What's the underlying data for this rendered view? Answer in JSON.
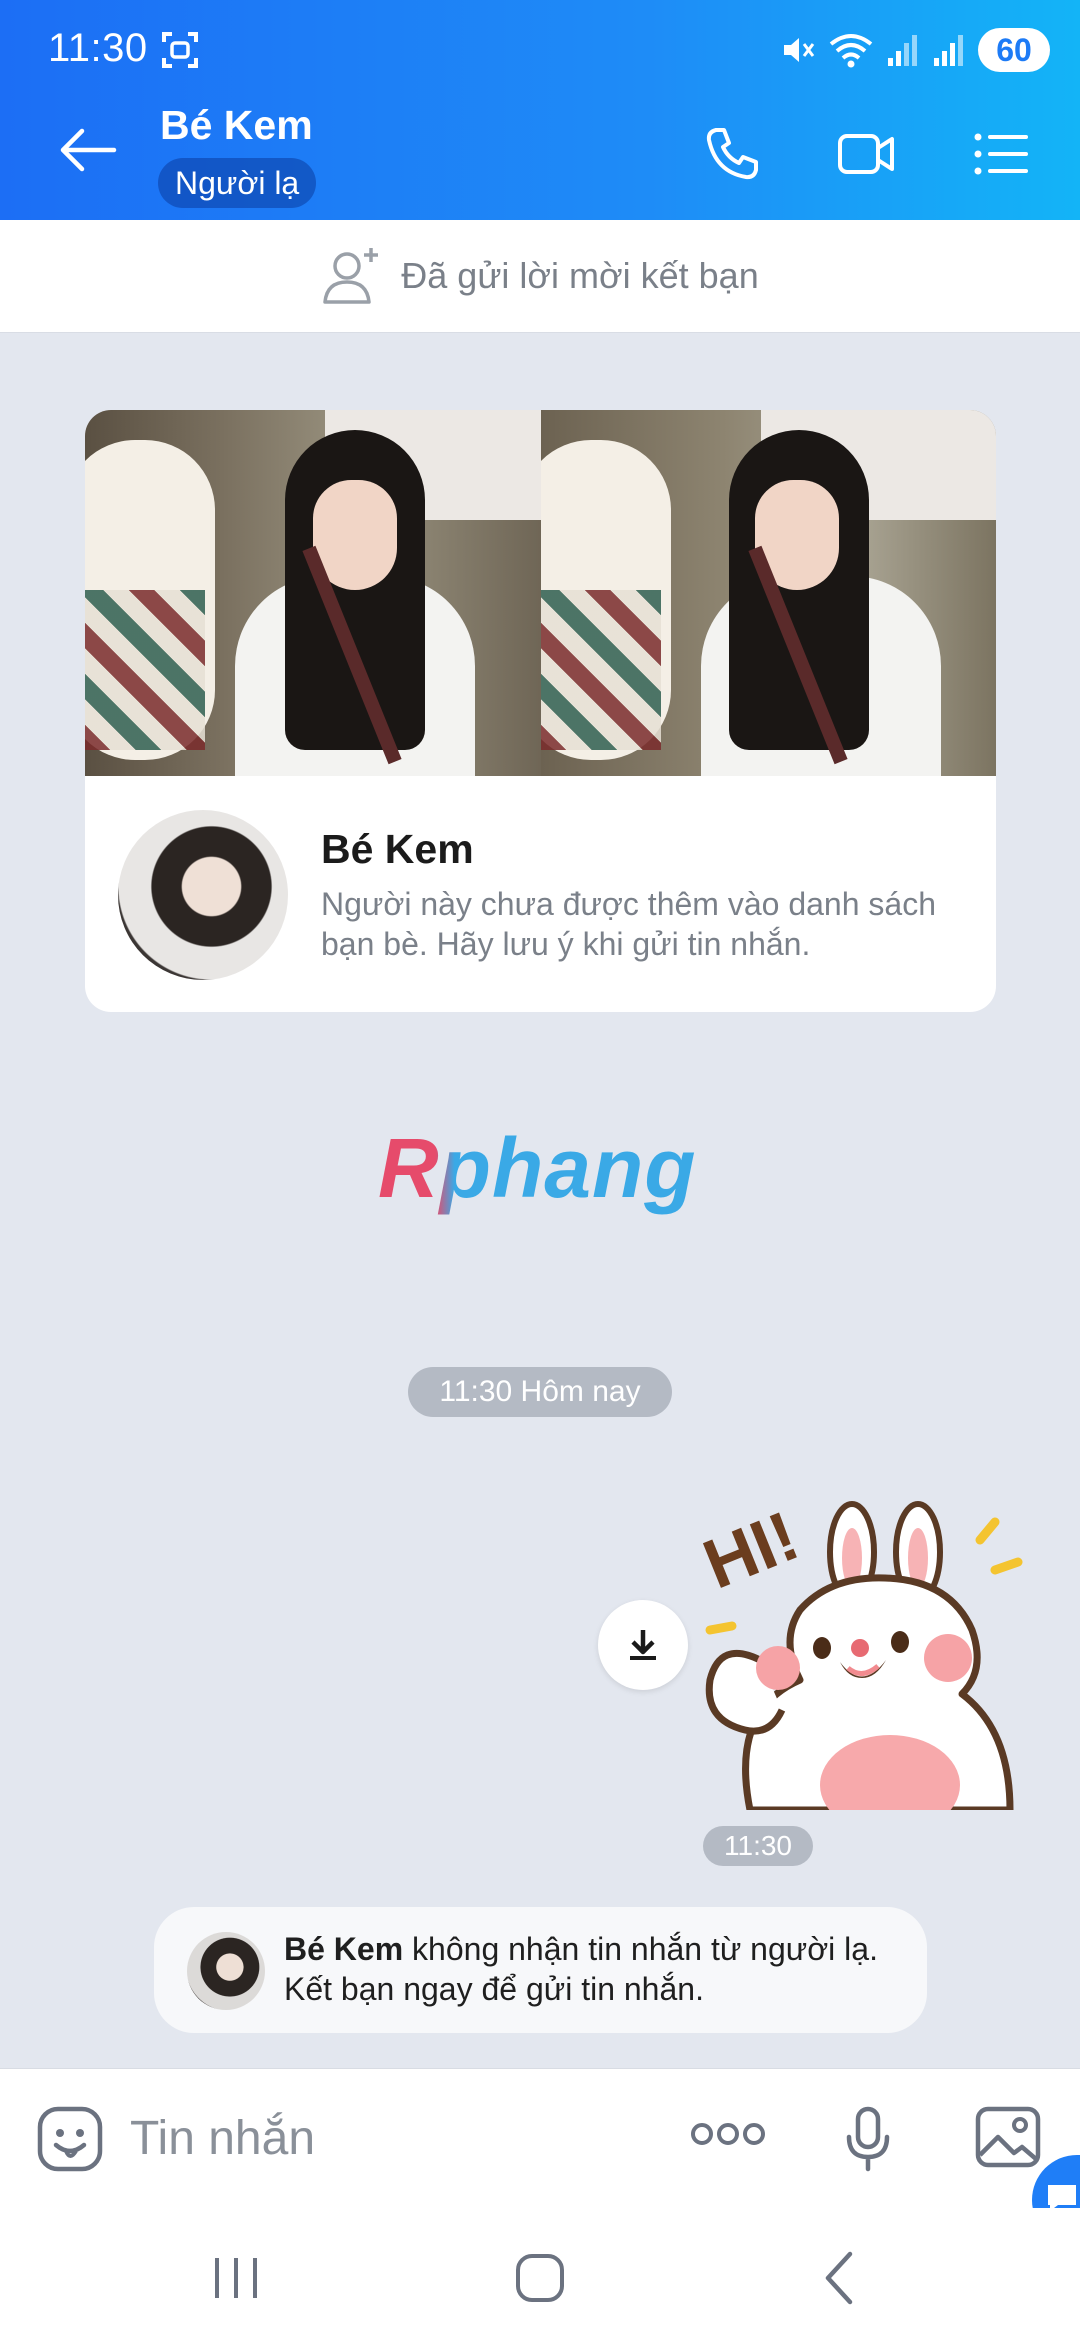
{
  "status_bar": {
    "time": "11:30",
    "battery": "60",
    "icons": [
      "screenshot-icon",
      "mute-icon",
      "wifi-icon",
      "signal-icon",
      "signal-icon"
    ]
  },
  "header": {
    "title": "Bé Kem",
    "badge": "Người lạ",
    "icons": [
      "back-arrow-icon",
      "phone-icon",
      "video-call-icon",
      "menu-list-icon"
    ]
  },
  "friend_request": {
    "text": "Đã gửi lời mời kết bạn",
    "icon": "add-friend-icon"
  },
  "profile_card": {
    "name": "Bé Kem",
    "note": "Người này chưa được thêm vào danh sách bạn bè. Hãy lưu ý khi gửi tin nhắn."
  },
  "watermark": "Rphang",
  "conversation": {
    "day_divider": "11:30 Hôm nay",
    "sticker_time": "11:30",
    "sticker_name": "bunny-hi-sticker",
    "sticker_text": "HI!"
  },
  "system_message": {
    "name": "Bé Kem",
    "text": " không nhận tin nhắn từ người lạ. Kết bạn ngay để gửi tin nhắn."
  },
  "input": {
    "placeholder": "Tin nhắn",
    "icons": [
      "emoji-icon",
      "more-icon",
      "microphone-icon",
      "image-icon"
    ]
  },
  "nav": {
    "icons": [
      "recent-apps-icon",
      "home-icon",
      "back-nav-icon"
    ]
  },
  "colors": {
    "header_start": "#1c6ef5",
    "header_end": "#13b4f7",
    "chat_bg": "#e3e7ef",
    "accent": "#1f7ef7"
  }
}
